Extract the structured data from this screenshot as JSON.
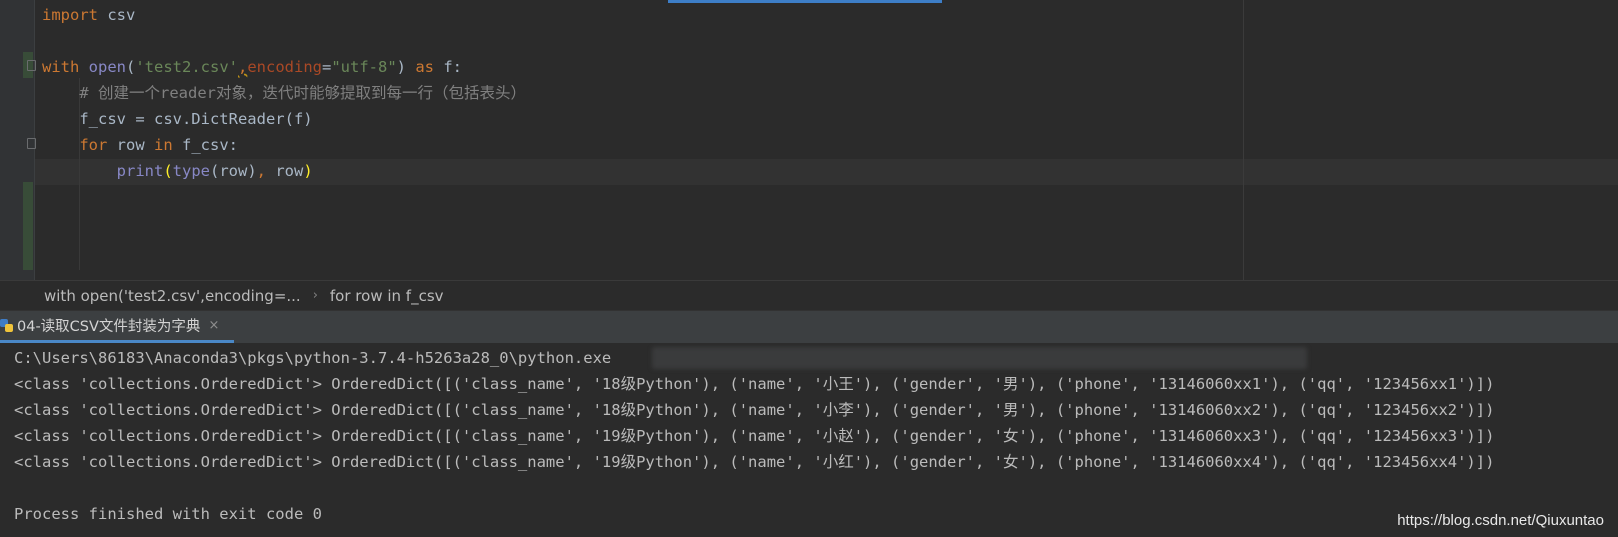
{
  "editor": {
    "lines": [
      [
        {
          "t": "import",
          "c": "kw"
        },
        {
          "t": " csv",
          "c": ""
        }
      ],
      [],
      [
        {
          "t": "with",
          "c": "kw"
        },
        {
          "t": " ",
          "c": ""
        },
        {
          "t": "open",
          "c": "bi"
        },
        {
          "t": "(",
          "c": ""
        },
        {
          "t": "'test2.csv'",
          "c": "str"
        },
        {
          "t": ",",
          "c": "warn-comma"
        },
        {
          "t": "encoding",
          "c": "param"
        },
        {
          "t": "=",
          "c": ""
        },
        {
          "t": "\"utf-8\"",
          "c": "str"
        },
        {
          "t": ") ",
          "c": ""
        },
        {
          "t": "as",
          "c": "kw"
        },
        {
          "t": " f:",
          "c": ""
        }
      ],
      [
        {
          "t": "    # 创建一个reader对象，迭代时能够提取到每一行（包括表头）",
          "c": "cmt"
        }
      ],
      [
        {
          "t": "    f_csv = csv.DictReader(f)",
          "c": ""
        }
      ],
      [
        {
          "t": "    ",
          "c": ""
        },
        {
          "t": "for",
          "c": "kw"
        },
        {
          "t": " row ",
          "c": ""
        },
        {
          "t": "in",
          "c": "kw"
        },
        {
          "t": " f_csv:",
          "c": ""
        }
      ],
      [
        {
          "t": "        ",
          "c": ""
        },
        {
          "t": "print",
          "c": "bi"
        },
        {
          "t": "(",
          "c": "brace-hl"
        },
        {
          "t": "type",
          "c": "bi"
        },
        {
          "t": "(row)",
          "c": ""
        },
        {
          "t": ",",
          "c": "kw"
        },
        {
          "t": " row",
          "c": ""
        },
        {
          "t": ")",
          "c": "brace-hl"
        }
      ]
    ]
  },
  "breadcrumb": {
    "item1": "with open('test2.csv',encoding=...",
    "separator": "›",
    "item2": "for row in f_csv"
  },
  "run_panel": {
    "tab_label": "04-读取CSV文件封装为字典",
    "close_glyph": "×"
  },
  "console": {
    "lines": [
      "C:\\Users\\86183\\Anaconda3\\pkgs\\python-3.7.4-h5263a28_0\\python.exe",
      "<class 'collections.OrderedDict'> OrderedDict([('class_name', '18级Python'), ('name', '小王'), ('gender', '男'), ('phone', '13146060xx1'), ('qq', '123456xx1')])",
      "<class 'collections.OrderedDict'> OrderedDict([('class_name', '18级Python'), ('name', '小李'), ('gender', '男'), ('phone', '13146060xx2'), ('qq', '123456xx2')])",
      "<class 'collections.OrderedDict'> OrderedDict([('class_name', '19级Python'), ('name', '小赵'), ('gender', '女'), ('phone', '13146060xx3'), ('qq', '123456xx3')])",
      "<class 'collections.OrderedDict'> OrderedDict([('class_name', '19级Python'), ('name', '小红'), ('gender', '女'), ('phone', '13146060xx4'), ('qq', '123456xx4')])",
      "",
      "Process finished with exit code 0"
    ]
  },
  "watermark": "https://blog.csdn.net/Qiuxuntao",
  "colors": {
    "background": "#2b2b2b",
    "keyword": "#cc7832",
    "string": "#6a8759",
    "builtin": "#8888c6",
    "comment": "#808080",
    "accent": "#4a88c7"
  }
}
